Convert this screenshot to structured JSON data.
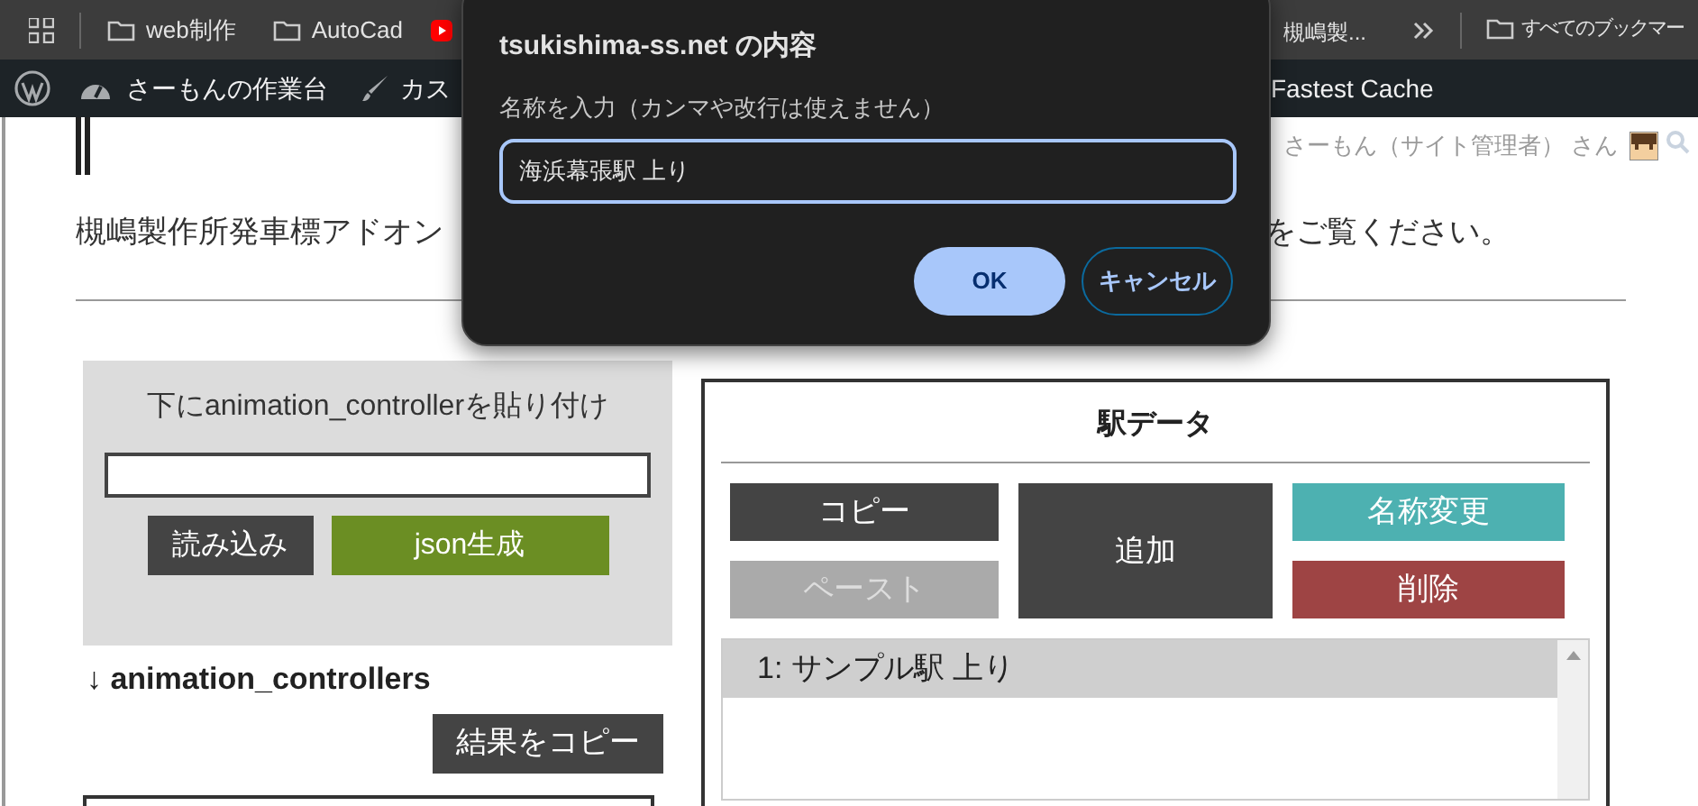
{
  "bookmarks_bar": {
    "items": [
      {
        "kind": "apps"
      },
      {
        "kind": "folder",
        "label": "web制作"
      },
      {
        "kind": "folder",
        "label": "AutoCad"
      },
      {
        "kind": "video"
      },
      {
        "kind": "page",
        "label": "槻嶋製..."
      },
      {
        "kind": "overflow"
      },
      {
        "kind": "folder",
        "label": "すべてのブックマー"
      }
    ]
  },
  "admin_bar": {
    "items": [
      {
        "kind": "wordpress"
      },
      {
        "kind": "dashboard",
        "label": "さーもんの作業台"
      },
      {
        "kind": "customize",
        "label": "カス"
      },
      {
        "kind": "plain",
        "label": "Fastest Cache"
      }
    ],
    "user": {
      "label": "さーもん（サイト管理者） さん"
    }
  },
  "page": {
    "intro": [
      "槻嶋製作所発車標アドオン",
      "をご覧ください。"
    ],
    "import_panel": {
      "label": "下にanimation_controllerを貼り付け",
      "buttons": [
        {
          "label": "読み込み",
          "kind": "dark"
        },
        {
          "label": "json生成",
          "kind": "green"
        }
      ]
    },
    "output": {
      "heading": "↓ animation_controllers",
      "copy_button": "結果をコピー"
    },
    "station_panel": {
      "title": "駅データ",
      "buttons": [
        {
          "label": "コピー",
          "kind": "dark",
          "disabled": false
        },
        {
          "label": "ペースト",
          "kind": "dark",
          "disabled": true
        },
        {
          "label": "追加",
          "kind": "tall",
          "disabled": false
        },
        {
          "label": "名称変更",
          "kind": "teal",
          "disabled": false
        },
        {
          "label": "削除",
          "kind": "red",
          "disabled": false
        }
      ],
      "stations": [
        {
          "label": "1: サンプル駅 上り",
          "selected": true
        }
      ]
    }
  },
  "dialog": {
    "title": "tsukishima-ss.net の内容",
    "message": "名称を入力（カンマや改行は使えません）",
    "value": "海浜幕張駅 上り",
    "buttons": [
      {
        "label": "OK",
        "kind": "primary"
      },
      {
        "label": "キャンセル",
        "kind": "secondary"
      }
    ]
  }
}
